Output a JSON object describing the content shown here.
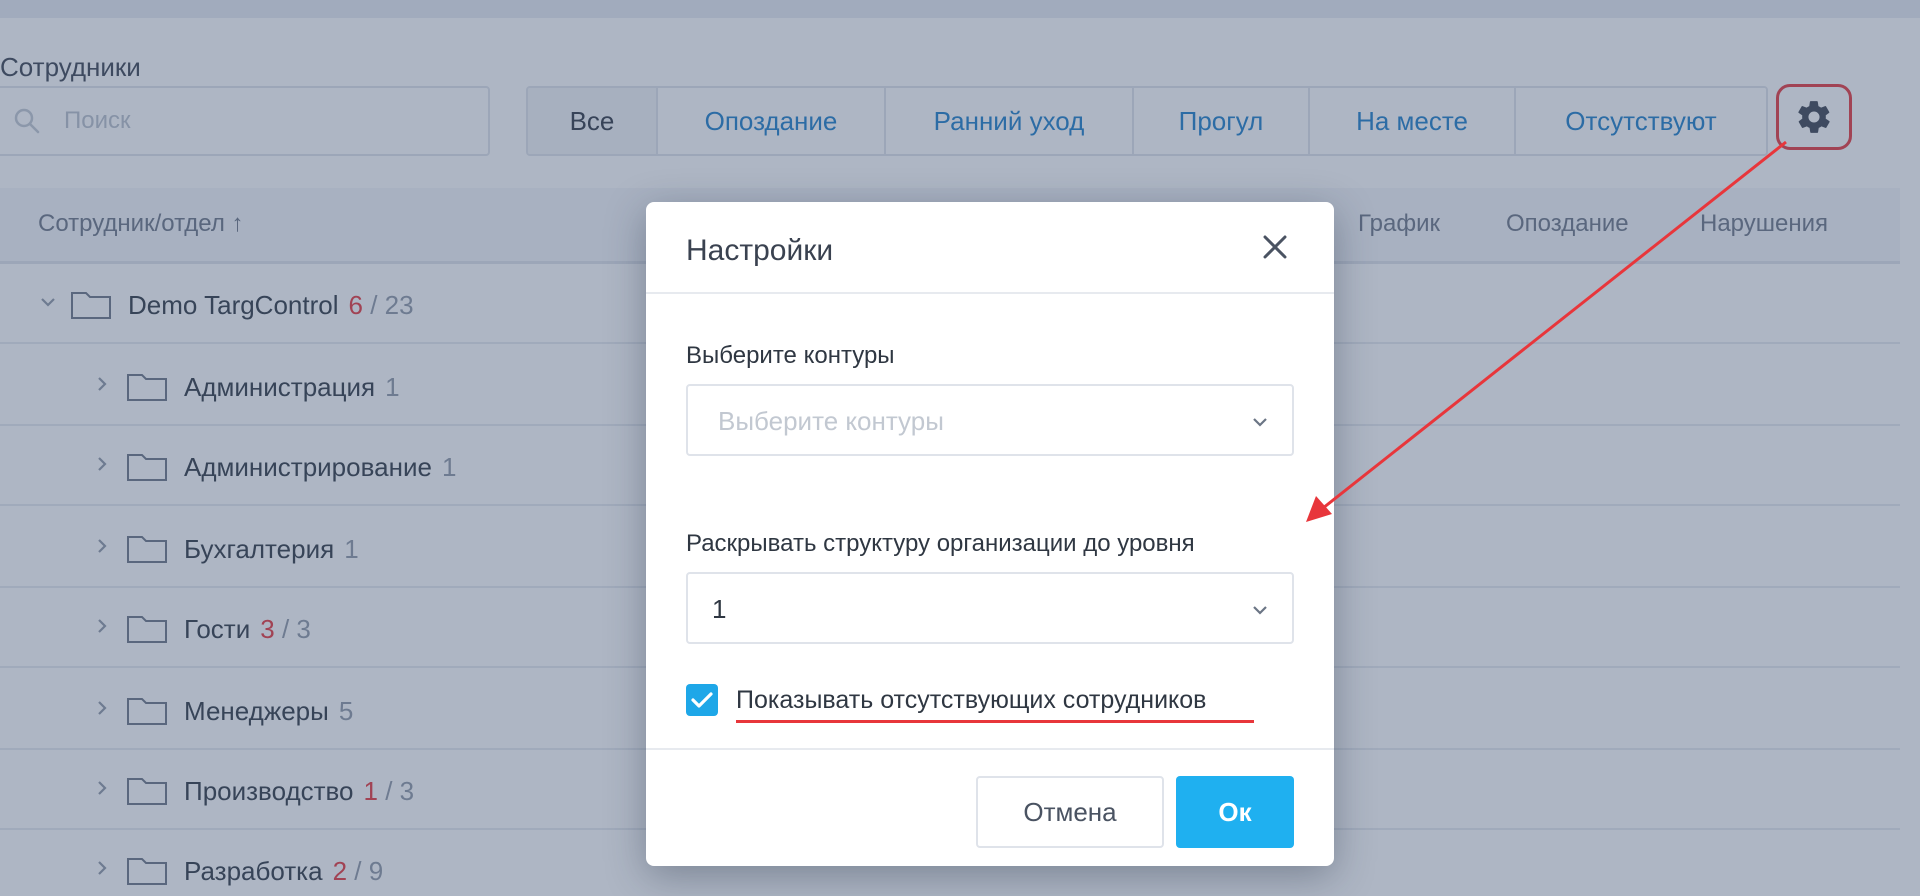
{
  "page": {
    "section_title": "Сотрудники",
    "search_placeholder": "Поиск"
  },
  "tabs": [
    {
      "label": "Все",
      "active": true
    },
    {
      "label": "Опоздание",
      "active": false
    },
    {
      "label": "Ранний уход",
      "active": false
    },
    {
      "label": "Прогул",
      "active": false
    },
    {
      "label": "На месте",
      "active": false
    },
    {
      "label": "Отсутствуют",
      "active": false
    }
  ],
  "settings_button_icon": "gear-icon",
  "table": {
    "columns": {
      "employee": "Сотрудник/отдел ↑",
      "schedule": "График",
      "late": "Опоздание",
      "violations": "Нарушения"
    },
    "rows": [
      {
        "name": "Demo TargControl",
        "late": "6",
        "total": "/ 23",
        "expanded": true
      },
      {
        "name": "Администрация",
        "late": "",
        "total": "1",
        "expanded": false
      },
      {
        "name": "Администрирование",
        "late": "",
        "total": "1",
        "expanded": false
      },
      {
        "name": "Бухгалтерия",
        "late": "",
        "total": "1",
        "expanded": false
      },
      {
        "name": "Гости",
        "late": "3",
        "total": "/ 3",
        "expanded": false
      },
      {
        "name": "Менеджеры",
        "late": "",
        "total": "5",
        "expanded": false
      },
      {
        "name": "Производство",
        "late": "1",
        "total": "/ 3",
        "expanded": false
      },
      {
        "name": "Разработка",
        "late": "2",
        "total": "/ 9",
        "expanded": false
      }
    ]
  },
  "modal": {
    "title": "Настройки",
    "contours_label": "Выберите контуры",
    "contours_placeholder": "Выберите контуры",
    "level_label": "Раскрывать структуру организации до уровня",
    "level_value": "1",
    "show_absent_label": "Показывать отсутствующих сотрудников",
    "show_absent_checked": true,
    "cancel_label": "Отмена",
    "ok_label": "Ок"
  },
  "colors": {
    "accent_blue": "#1fb0f0",
    "link_blue": "#1c7dc9",
    "annotation_red": "#e8363b",
    "late_red": "#e8363b"
  }
}
